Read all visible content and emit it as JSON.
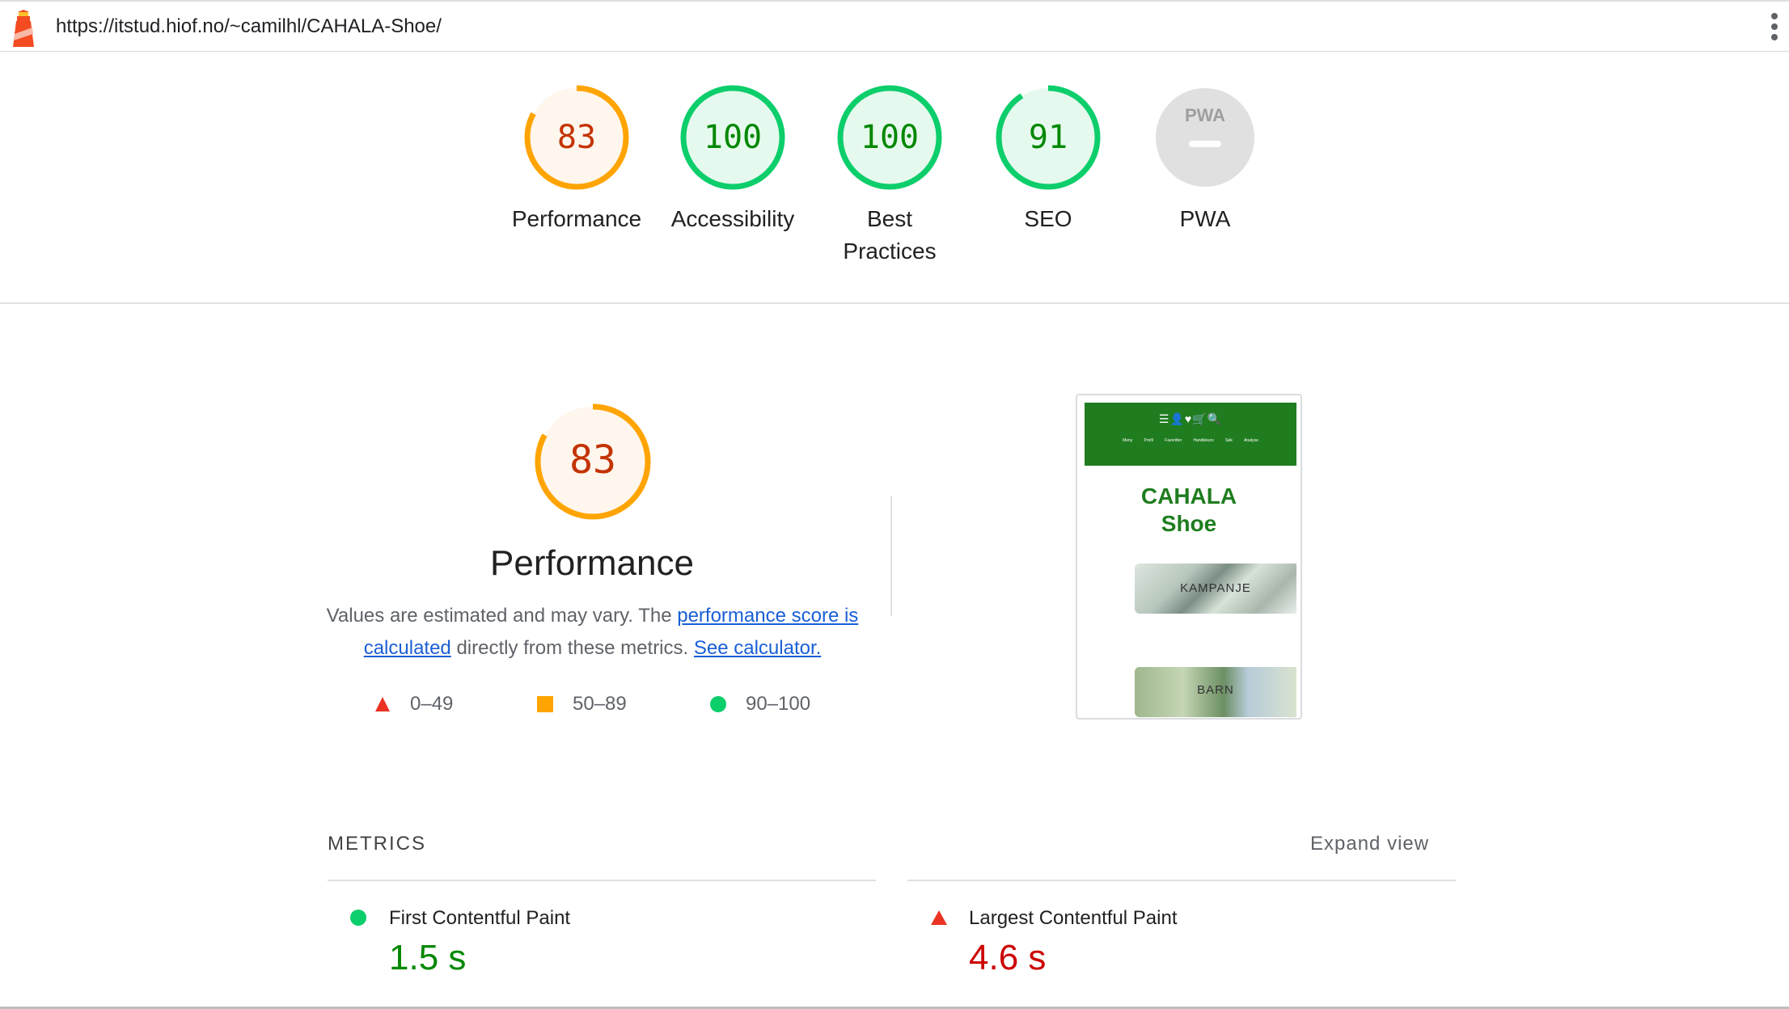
{
  "url_bar": {
    "url": "https://itstud.hiof.no/~camilhl/CAHALA-Shoe/"
  },
  "gauges": [
    {
      "score": "83",
      "label": "Performance",
      "value": 83,
      "color": "#ffa400",
      "text_color": "#c33300",
      "fill": "#fff6ed"
    },
    {
      "score": "100",
      "label": "Accessibility",
      "value": 100,
      "color": "#0cce6b",
      "text_color": "#008800",
      "fill": "#e6f9ee"
    },
    {
      "score": "100",
      "label": "Best Practices",
      "value": 100,
      "color": "#0cce6b",
      "text_color": "#008800",
      "fill": "#e6f9ee"
    },
    {
      "score": "91",
      "label": "SEO",
      "value": 91,
      "color": "#0cce6b",
      "text_color": "#008800",
      "fill": "#e6f9ee"
    },
    {
      "score": "PWA",
      "label": "PWA",
      "value": null,
      "color": "#e0e0e0",
      "text_color": "#9e9e9e",
      "fill": "#e0e0e0"
    }
  ],
  "performance": {
    "score": "83",
    "title": "Performance",
    "desc_prefix": "Values are estimated and may vary. The ",
    "link_score": "performance score is calculated",
    "desc_middle": " directly from these metrics. ",
    "link_calc": "See calculator."
  },
  "legend": [
    {
      "range": "0–49",
      "icon": "triangle-icon",
      "color": "#eb3323"
    },
    {
      "range": "50–89",
      "icon": "square-icon",
      "color": "#ffa400"
    },
    {
      "range": "90–100",
      "icon": "circle-icon",
      "color": "#0cce6b"
    }
  ],
  "thumbnail": {
    "icons": "☰👤♥🛒🔍",
    "nav": [
      "Meny",
      "Profil",
      "Favoritter",
      "Handlekurv",
      "Søk",
      "Analyse"
    ],
    "brand_line1": "CAHALA",
    "brand_line2": "Shoe",
    "image1_label": "KAMPANJE",
    "image2_label": "BARN"
  },
  "metrics": {
    "heading": "METRICS",
    "expand": "Expand view",
    "items": [
      {
        "title": "First Contentful Paint",
        "value": "1.5 s",
        "status": "pass",
        "color": "#008800"
      },
      {
        "title": "Largest Contentful Paint",
        "value": "4.6 s",
        "status": "fail",
        "color": "#cc0000"
      }
    ]
  }
}
